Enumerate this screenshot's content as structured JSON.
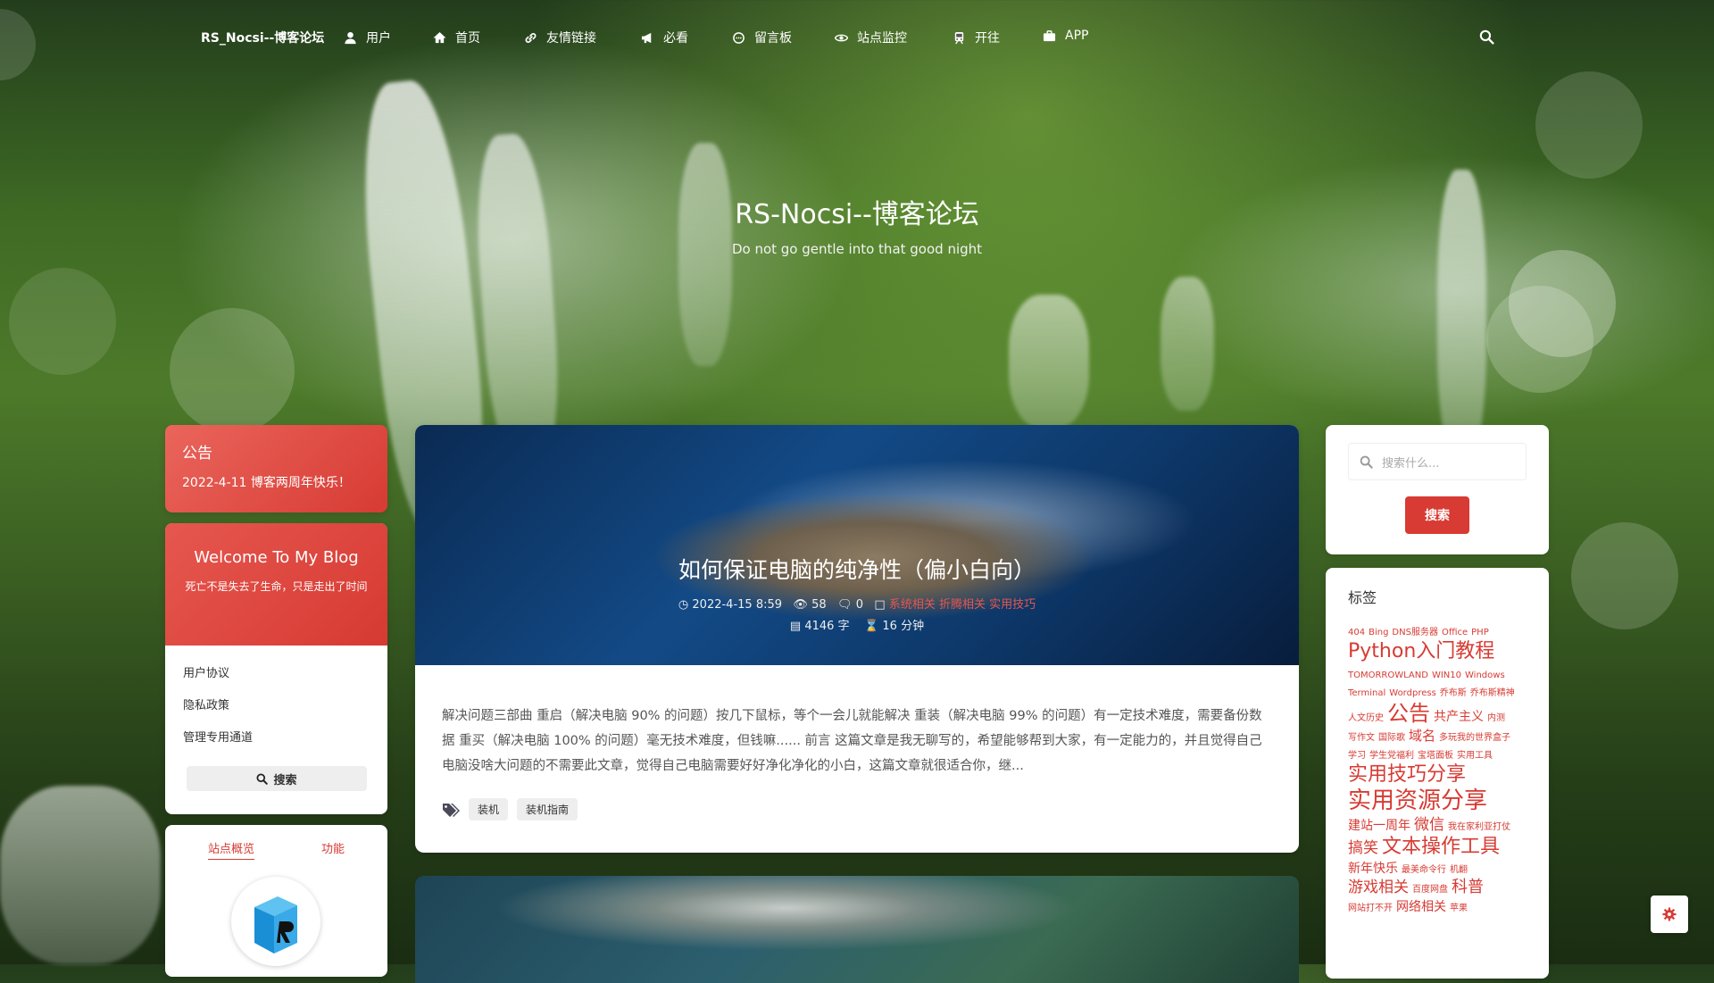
{
  "nav": {
    "brand": "RS_Nocsi--博客论坛",
    "items": [
      {
        "label": "用户",
        "icon": "user-icon"
      },
      {
        "label": "首页",
        "icon": "home-icon"
      },
      {
        "label": "友情链接",
        "icon": "link-icon"
      },
      {
        "label": "必看",
        "icon": "bullhorn-icon"
      },
      {
        "label": "留言板",
        "icon": "comment-icon"
      },
      {
        "label": "站点监控",
        "icon": "eye-icon"
      },
      {
        "label": "开往",
        "icon": "train-icon"
      },
      {
        "label": "APP",
        "icon": "briefcase-icon"
      }
    ],
    "search_icon": "search-icon"
  },
  "hero": {
    "title": "RS-Nocsi--博客论坛",
    "subtitle": "Do not go gentle into that good night"
  },
  "notice": {
    "title": "公告",
    "text": "2022-4-11 博客两周年快乐！"
  },
  "welcome": {
    "title": "Welcome To My Blog",
    "subtitle": "死亡不是失去了生命，只是走出了时间",
    "links": [
      "用户协议",
      "隐私政策",
      "管理专用通道"
    ],
    "search_label": "搜索"
  },
  "stats": {
    "tabs": [
      "站点概览",
      "功能"
    ]
  },
  "post": {
    "title": "如何保证电脑的纯净性（偏小白向）",
    "date": "2022-4-15 8:59",
    "views": "58",
    "comments": "0",
    "categories": "系统相关 折腾相关 实用技巧",
    "words": "4146 字",
    "read_time": "16 分钟",
    "excerpt": "解决问题三部曲 重启（解决电脑 90% 的问题）按几下鼠标，等个一会儿就能解决 重装（解决电脑 99% 的问题）有一定技术难度，需要备份数据 重买（解决电脑 100% 的问题）毫无技术难度，但钱嘛...... 前言 这篇文章是我无聊写的，希望能够帮到大家，有一定能力的，并且觉得自己电脑没啥大问题的不需要此文章，觉得自己电脑需要好好净化净化的小白，这篇文章就很适合你，继...",
    "tags": [
      "装机",
      "装机指南"
    ]
  },
  "sidebar_search": {
    "placeholder": "搜索什么...",
    "button": "搜索"
  },
  "tags_widget": {
    "title": "标签",
    "tags": [
      {
        "t": "404",
        "s": 10
      },
      {
        "t": "Bing",
        "s": 10
      },
      {
        "t": "DNS服务器",
        "s": 10
      },
      {
        "t": "Office",
        "s": 10
      },
      {
        "t": "PHP",
        "s": 10
      },
      {
        "t": "Python入门教程",
        "s": 22
      },
      {
        "t": "TOMORROWLAND",
        "s": 10
      },
      {
        "t": "WIN10",
        "s": 10
      },
      {
        "t": "Windows",
        "s": 10
      },
      {
        "t": "Terminal",
        "s": 10
      },
      {
        "t": "Wordpress",
        "s": 10
      },
      {
        "t": "乔布斯",
        "s": 10
      },
      {
        "t": "乔布斯精神",
        "s": 10
      },
      {
        "t": "人文历史",
        "s": 10
      },
      {
        "t": "公告",
        "s": 24
      },
      {
        "t": "共产主义",
        "s": 14
      },
      {
        "t": "内测",
        "s": 10
      },
      {
        "t": "写作文",
        "s": 10
      },
      {
        "t": "国际歌",
        "s": 10
      },
      {
        "t": "域名",
        "s": 15
      },
      {
        "t": "多玩我的世界盒子",
        "s": 10
      },
      {
        "t": "学习",
        "s": 10
      },
      {
        "t": "学生党福利",
        "s": 10
      },
      {
        "t": "宝塔面板",
        "s": 10
      },
      {
        "t": "实用工具",
        "s": 10
      },
      {
        "t": "实用技巧分享",
        "s": 22
      },
      {
        "t": "实用资源分享",
        "s": 26
      },
      {
        "t": "建站一周年",
        "s": 14
      },
      {
        "t": "微信",
        "s": 17
      },
      {
        "t": "我在家利亚打仗",
        "s": 10
      },
      {
        "t": "搞笑",
        "s": 17
      },
      {
        "t": "文本操作工具",
        "s": 22
      },
      {
        "t": "新年快乐",
        "s": 14
      },
      {
        "t": "最美命令行",
        "s": 10
      },
      {
        "t": "机翻",
        "s": 10
      },
      {
        "t": "游戏相关",
        "s": 17
      },
      {
        "t": "百度网盘",
        "s": 10
      },
      {
        "t": "科普",
        "s": 18
      },
      {
        "t": "网站打不开",
        "s": 10
      },
      {
        "t": "网络相关",
        "s": 14
      },
      {
        "t": "苹果",
        "s": 10
      }
    ]
  },
  "colors": {
    "accent": "#d73b33",
    "card": "#ffffff"
  }
}
